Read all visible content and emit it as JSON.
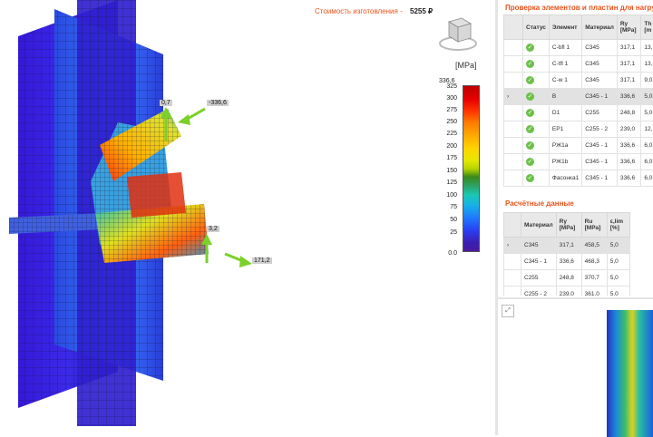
{
  "header": {
    "cost_label": "Стоимость изготовления",
    "cost_sep": "-",
    "cost_value": "5255 ₽"
  },
  "legend": {
    "unit": "[MPa]",
    "top": "336,6",
    "ticks": [
      "325",
      "300",
      "275",
      "250",
      "225",
      "200",
      "175",
      "150",
      "125",
      "100",
      "75",
      "50",
      "25",
      "0.0"
    ]
  },
  "loads": {
    "l1": "0,7",
    "l2": "-336,6",
    "l3": "3,2",
    "l4": "171,2"
  },
  "check_table": {
    "title": "Проверка элементов и пластин для нагру",
    "headers": [
      "Статус",
      "Элемент",
      "Материал",
      "Ry [MPa]",
      "Th [m"
    ],
    "rows": [
      {
        "element": "C-bfl 1",
        "material": "C345",
        "ry": "317,1",
        "th": "13,"
      },
      {
        "element": "C-tfl 1",
        "material": "C345",
        "ry": "317,1",
        "th": "13,"
      },
      {
        "element": "C-w 1",
        "material": "C345",
        "ry": "317,1",
        "th": "9,0"
      },
      {
        "element": "B",
        "material": "C345 - 1",
        "ry": "336,6",
        "th": "5,0"
      },
      {
        "element": "D1",
        "material": "C255",
        "ry": "248,8",
        "th": "5,0"
      },
      {
        "element": "EP1",
        "material": "C255 - 2",
        "ry": "239,0",
        "th": "12,"
      },
      {
        "element": "РЖ1a",
        "material": "C345 - 1",
        "ry": "336,6",
        "th": "6,0"
      },
      {
        "element": "РЖ1b",
        "material": "C345 - 1",
        "ry": "336,6",
        "th": "6,0"
      },
      {
        "element": "Фасонка1",
        "material": "C345 - 1",
        "ry": "336,6",
        "th": "6,0"
      }
    ]
  },
  "calc_table": {
    "title": "Расчётные данные",
    "headers": [
      "Материал",
      "Ry [MPa]",
      "Ru [MPa]",
      "ε,lim [%]"
    ],
    "rows": [
      {
        "material": "C345",
        "ry": "317,1",
        "ru": "458,5",
        "elim": "5,0"
      },
      {
        "material": "C345 - 1",
        "ry": "336,6",
        "ru": "468,3",
        "elim": "5,0"
      },
      {
        "material": "C255",
        "ry": "248,8",
        "ru": "370,7",
        "elim": "5,0"
      },
      {
        "material": "C255 - 2",
        "ry": "239,0",
        "ru": "361,0",
        "elim": "5,0"
      }
    ]
  },
  "colors": {
    "accent": "#e8541c",
    "ok": "#6cc04a"
  }
}
